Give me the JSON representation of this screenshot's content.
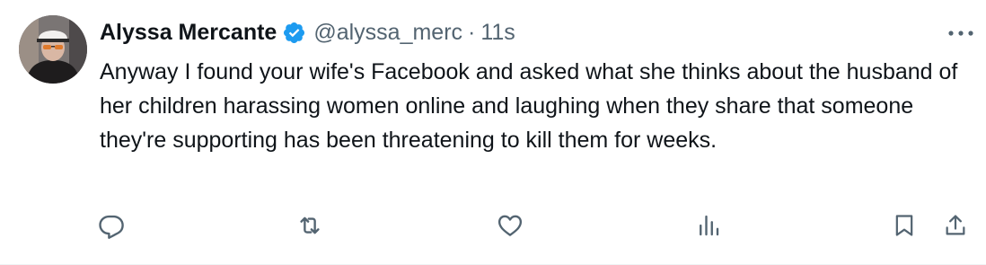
{
  "tweet": {
    "author": {
      "display_name": "Alyssa Mercante",
      "handle": "@alyssa_merc",
      "verified": true,
      "avatar_icon": "profile-photo"
    },
    "separator": "·",
    "time": "11s",
    "text": "Anyway I found your wife's Facebook and asked what she thinks about the husband of her children harassing women online and laughing when they share that someone they're supporting has been threatening to kill them for weeks.",
    "colors": {
      "text": "#0f1419",
      "muted": "#536471",
      "verified_badge": "#1d9bf0",
      "background": "#ffffff"
    },
    "actions": [
      {
        "icon": "reply-icon"
      },
      {
        "icon": "retweet-icon"
      },
      {
        "icon": "like-icon"
      },
      {
        "icon": "views-icon"
      },
      {
        "icon": "bookmark-icon"
      },
      {
        "icon": "share-icon"
      }
    ],
    "more_icon": "more-icon"
  }
}
